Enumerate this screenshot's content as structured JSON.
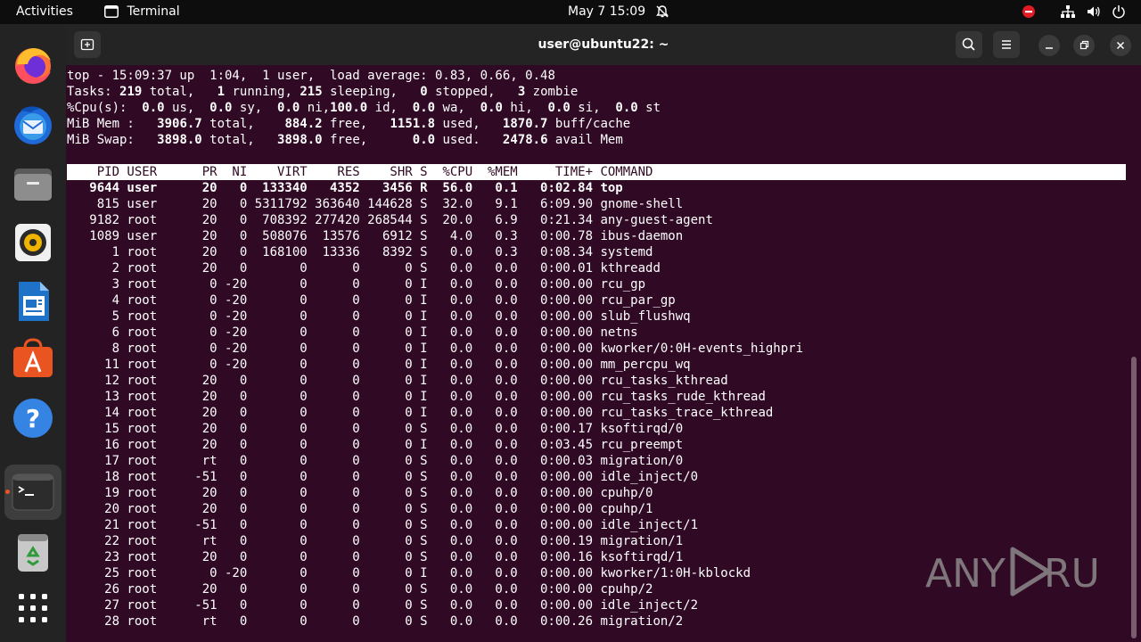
{
  "topbar": {
    "activities": "Activities",
    "app_name": "Terminal",
    "datetime": "May 7  15:09"
  },
  "window": {
    "title": "user@ubuntu22: ~"
  },
  "top": {
    "summary": [
      "top - 15:09:37 up  1:04,  1 user,  load average: 0.83, 0.66, 0.48",
      "Tasks: 219 total,   1 running, 215 sleeping,   0 stopped,   3 zombie",
      "%Cpu(s):  0.0 us,  0.0 sy,  0.0 ni,100.0 id,  0.0 wa,  0.0 hi,  0.0 si,  0.0 st",
      "MiB Mem :   3906.7 total,    884.2 free,   1151.8 used,   1870.7 buff/cache",
      "MiB Swap:   3898.0 total,   3898.0 free,      0.0 used.   2478.6 avail Mem"
    ],
    "header": "    PID USER      PR  NI    VIRT    RES    SHR S  %CPU  %MEM     TIME+ COMMAND",
    "processes": [
      "   9644 user      20   0  133340   4352   3456 R  56.0   0.1   0:02.84 top",
      "    815 user      20   0 5311792 363640 144628 S  32.0   9.1   6:09.90 gnome-shell",
      "   9182 root      20   0  708392 277420 268544 S  20.0   6.9   0:21.34 any-guest-agent",
      "   1089 user      20   0  508076  13576   6912 S   4.0   0.3   0:00.78 ibus-daemon",
      "      1 root      20   0  168100  13336   8392 S   0.0   0.3   0:08.34 systemd",
      "      2 root      20   0       0      0      0 S   0.0   0.0   0:00.01 kthreadd",
      "      3 root       0 -20       0      0      0 I   0.0   0.0   0:00.00 rcu_gp",
      "      4 root       0 -20       0      0      0 I   0.0   0.0   0:00.00 rcu_par_gp",
      "      5 root       0 -20       0      0      0 I   0.0   0.0   0:00.00 slub_flushwq",
      "      6 root       0 -20       0      0      0 I   0.0   0.0   0:00.00 netns",
      "      8 root       0 -20       0      0      0 I   0.0   0.0   0:00.00 kworker/0:0H-events_highpri",
      "     11 root       0 -20       0      0      0 I   0.0   0.0   0:00.00 mm_percpu_wq",
      "     12 root      20   0       0      0      0 I   0.0   0.0   0:00.00 rcu_tasks_kthread",
      "     13 root      20   0       0      0      0 I   0.0   0.0   0:00.00 rcu_tasks_rude_kthread",
      "     14 root      20   0       0      0      0 I   0.0   0.0   0:00.00 rcu_tasks_trace_kthread",
      "     15 root      20   0       0      0      0 S   0.0   0.0   0:00.17 ksoftirqd/0",
      "     16 root      20   0       0      0      0 I   0.0   0.0   0:03.45 rcu_preempt",
      "     17 root      rt   0       0      0      0 S   0.0   0.0   0:00.03 migration/0",
      "     18 root     -51   0       0      0      0 S   0.0   0.0   0:00.00 idle_inject/0",
      "     19 root      20   0       0      0      0 S   0.0   0.0   0:00.00 cpuhp/0",
      "     20 root      20   0       0      0      0 S   0.0   0.0   0:00.00 cpuhp/1",
      "     21 root     -51   0       0      0      0 S   0.0   0.0   0:00.00 idle_inject/1",
      "     22 root      rt   0       0      0      0 S   0.0   0.0   0:00.19 migration/1",
      "     23 root      20   0       0      0      0 S   0.0   0.0   0:00.16 ksoftirqd/1",
      "     25 root       0 -20       0      0      0 I   0.0   0.0   0:00.00 kworker/1:0H-kblockd",
      "     26 root      20   0       0      0      0 S   0.0   0.0   0:00.00 cpuhp/2",
      "     27 root     -51   0       0      0      0 S   0.0   0.0   0:00.00 idle_inject/2",
      "     28 root      rt   0       0      0      0 S   0.0   0.0   0:00.26 migration/2"
    ]
  },
  "watermark": "ANY RUN",
  "colors": {
    "terminal_bg": "#300a24",
    "topbar_bg": "#0d0d0d",
    "dock_bg": "#232323",
    "accent": "#e95420"
  },
  "dock": {
    "items": [
      "firefox-icon",
      "thunderbird-icon",
      "files-icon",
      "rhythmbox-icon",
      "writer-icon",
      "app-center-icon",
      "help-icon",
      "terminal-icon",
      "trash-icon",
      "show-apps-icon"
    ]
  }
}
